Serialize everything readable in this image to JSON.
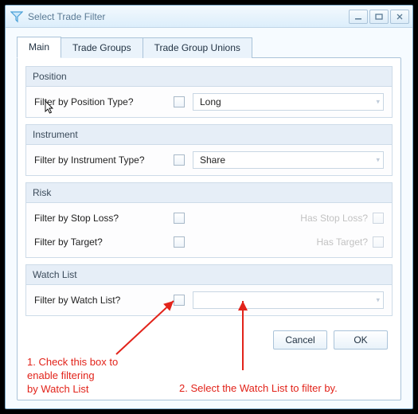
{
  "window": {
    "title": "Select Trade Filter",
    "icon": "funnel-icon"
  },
  "tabs": {
    "main": "Main",
    "tradeGroups": "Trade Groups",
    "tradeGroupUnions": "Trade Group Unions"
  },
  "groups": {
    "position": {
      "title": "Position",
      "filterLabel": "Filter by Position Type?",
      "value": "Long"
    },
    "instrument": {
      "title": "Instrument",
      "filterLabel": "Filter by Instrument Type?",
      "value": "Share"
    },
    "risk": {
      "title": "Risk",
      "stopLossLabel": "Filter by Stop Loss?",
      "hasStopLossLabel": "Has Stop Loss?",
      "targetLabel": "Filter by Target?",
      "hasTargetLabel": "Has Target?"
    },
    "watchList": {
      "title": "Watch List",
      "filterLabel": "Filter by Watch List?",
      "value": ""
    }
  },
  "buttons": {
    "cancel": "Cancel",
    "ok": "OK"
  },
  "annotations": {
    "a1": "1. Check this box to\nenable filtering\nby Watch List",
    "a2": "2. Select the Watch List to filter by."
  }
}
